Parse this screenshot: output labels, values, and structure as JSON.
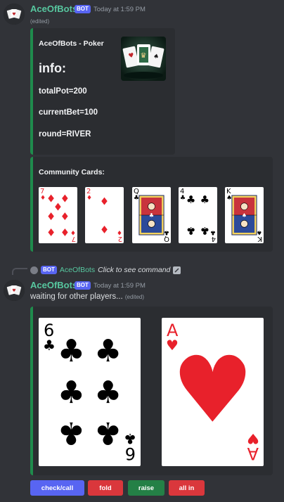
{
  "message1": {
    "author": "AceOfBots",
    "badge": "BOT",
    "timestamp": "Today at 1:59 PM",
    "edited": "(edited)",
    "embed": {
      "title": "AceOfBots - Poker",
      "heading": "info:",
      "fields": [
        "totalPot=200",
        "currentBet=100",
        "round=RIVER"
      ],
      "thumbnail_icon": "poker-cards-thumbnail"
    },
    "community": {
      "title": "Community Cards:",
      "cards": [
        {
          "rank": "7",
          "suit": "diamonds",
          "symbol": "♦",
          "color": "#e8212b"
        },
        {
          "rank": "2",
          "suit": "diamonds",
          "symbol": "♦",
          "color": "#e8212b"
        },
        {
          "rank": "Q",
          "suit": "clubs",
          "symbol": "♣",
          "color": "#000000"
        },
        {
          "rank": "4",
          "suit": "clubs",
          "symbol": "♣",
          "color": "#000000"
        },
        {
          "rank": "K",
          "suit": "spades",
          "symbol": "♠",
          "color": "#000000"
        }
      ]
    }
  },
  "message2": {
    "reply": {
      "badge": "BOT",
      "author": "AceOfBots",
      "command_text": "Click to see command"
    },
    "author": "AceOfBots",
    "badge": "BOT",
    "timestamp": "Today at 1:59 PM",
    "text": "waiting for other players...",
    "edited": "(edited)",
    "hand": [
      {
        "rank": "6",
        "suit": "clubs",
        "symbol": "♣",
        "color": "#000000"
      },
      {
        "rank": "A",
        "suit": "hearts",
        "symbol": "♥",
        "color": "#e8212b"
      }
    ],
    "buttons": [
      {
        "label": "check/call",
        "color": "#5865f2"
      },
      {
        "label": "fold",
        "color": "#da373c"
      },
      {
        "label": "raise",
        "color": "#248046"
      },
      {
        "label": "all in",
        "color": "#da373c"
      }
    ]
  },
  "colors": {
    "background": "#313338",
    "embed": "#2b2d31",
    "embed_accent": "#1f8b4c",
    "author": "#57c79f"
  }
}
